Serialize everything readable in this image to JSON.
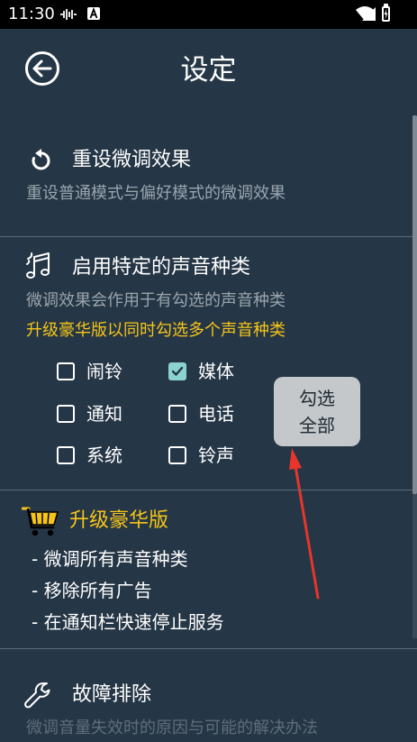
{
  "status_bar": {
    "time": "11:30",
    "icons": [
      "vibrate-icon",
      "a-notification-icon",
      "wifi-icon",
      "signal-icon",
      "battery-icon"
    ]
  },
  "header": {
    "title": "设定",
    "back_icon": "arrow-left-circle-icon"
  },
  "reset_section": {
    "icon": "refresh-icon",
    "title": "重设微调效果",
    "description": "重设普通模式与偏好模式的微调效果"
  },
  "sound_types_section": {
    "icon": "music-notes-icon",
    "title": "启用特定的声音种类",
    "description": "微调效果会作用于有勾选的声音种类",
    "upgrade_note": "升级豪华版以同时勾选多个声音种类",
    "options": [
      {
        "label": "闹铃",
        "checked": false
      },
      {
        "label": "媒体",
        "checked": true
      },
      {
        "label": "通知",
        "checked": false
      },
      {
        "label": "电话",
        "checked": false
      },
      {
        "label": "系统",
        "checked": false
      },
      {
        "label": "铃声",
        "checked": false
      }
    ],
    "select_all_line1": "勾选",
    "select_all_line2": "全部"
  },
  "premium_section": {
    "icon": "shopping-cart-icon",
    "title": "升级豪华版",
    "features": [
      "- 微调所有声音种类",
      "- 移除所有广告",
      "- 在通知栏快速停止服务"
    ]
  },
  "troubleshoot_section": {
    "icon": "wrench-icon",
    "title": "故障排除",
    "description": "微调音量失效时的原因与可能的解决办法"
  },
  "colors": {
    "background": "#253646",
    "accent_yellow": "#f5c518",
    "checkbox_checked": "#8cd3d0",
    "annotation_arrow": "#e8352b"
  }
}
